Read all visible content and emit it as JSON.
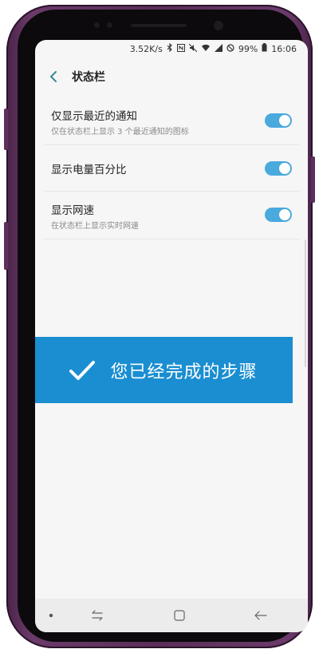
{
  "status_bar": {
    "network_speed": "3.52K/s",
    "battery_percent": "99%",
    "time": "16:06",
    "icons": [
      "bluetooth-icon",
      "nfc-icon",
      "mute-icon",
      "wifi-icon",
      "signal-icon",
      "do-not-disturb-icon",
      "battery-icon"
    ]
  },
  "header": {
    "title": "状态栏",
    "back_icon": "chevron-left-icon"
  },
  "settings": [
    {
      "title": "仅显示最近的通知",
      "subtitle": "仅在状态栏上显示 3 个最近通知的图标",
      "enabled": true
    },
    {
      "title": "显示电量百分比",
      "subtitle": "",
      "enabled": true
    },
    {
      "title": "显示网速",
      "subtitle": "在状态栏上显示实时网速",
      "enabled": true
    }
  ],
  "banner": {
    "text": "您已经完成的步骤",
    "icon": "checkmark-icon",
    "color": "#1a8ed1"
  },
  "nav_bar": {
    "buttons": [
      "dot-indicator-icon",
      "recent-apps-icon",
      "home-icon",
      "back-arrow-icon"
    ]
  },
  "colors": {
    "accent": "#4aa9dd",
    "phone_frame": "#5a2e58"
  }
}
